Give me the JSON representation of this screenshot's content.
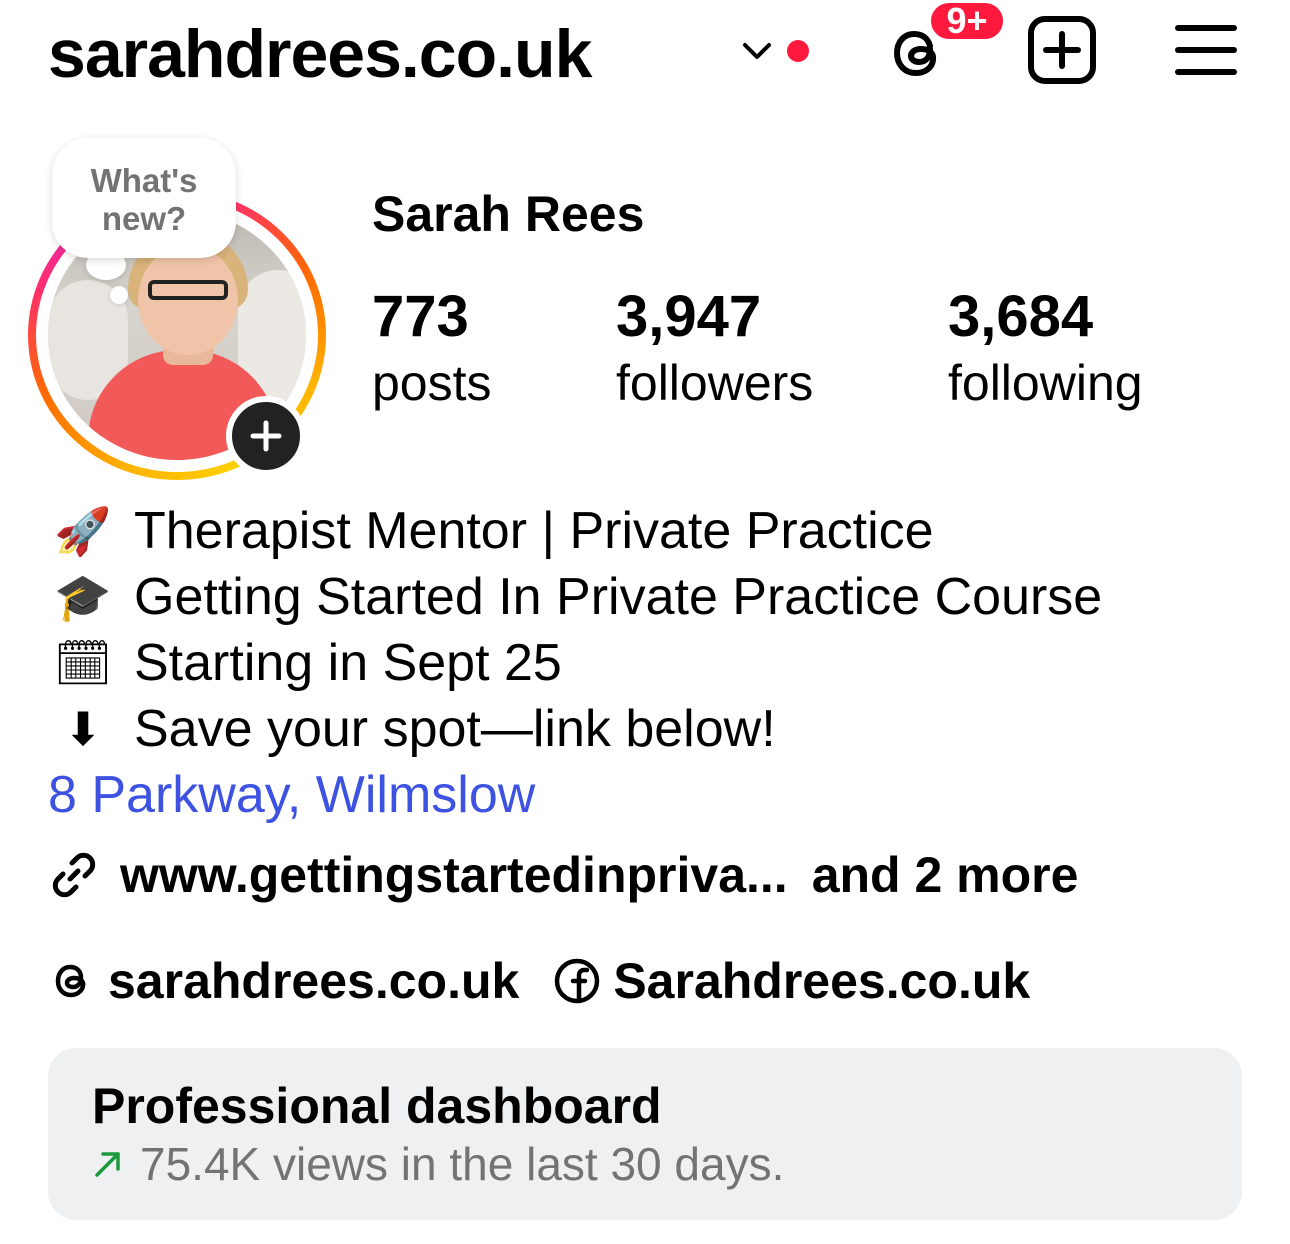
{
  "header": {
    "username": "sarahdrees.co.uk",
    "notification_badge": "9+",
    "icons": [
      "chevron-down-icon",
      "threads-icon",
      "create-post-icon",
      "menu-icon"
    ]
  },
  "profile": {
    "note_bubble": {
      "line1": "What's",
      "line2": "new?"
    },
    "full_name": "Sarah Rees",
    "stats": [
      {
        "value": "773",
        "label": "posts"
      },
      {
        "value": "3,947",
        "label": "followers"
      },
      {
        "value": "3,684",
        "label": "following"
      }
    ],
    "bio": [
      {
        "emoji": "🚀",
        "icon": "rocket-icon",
        "text": "Therapist Mentor | Private Practice"
      },
      {
        "emoji": "🎓",
        "icon": "graduation-cap-icon",
        "text": "Getting Started In Private Practice Course"
      },
      {
        "emoji": "🗓",
        "icon": "calendar-icon",
        "text": "Starting in Sept 25"
      },
      {
        "emoji": "⬇",
        "icon": "down-arrow-icon",
        "text": "Save your spot—link below!"
      }
    ],
    "address": "8 Parkway, Wilmslow",
    "link": {
      "url": "www.gettingstartedinpriva...",
      "more": "and 2 more"
    },
    "social": [
      {
        "icon": "threads-icon",
        "label": "sarahdrees.co.uk"
      },
      {
        "icon": "facebook-icon",
        "label": "Sarahdrees.co.uk"
      }
    ]
  },
  "dashboard": {
    "title": "Professional dashboard",
    "subtitle": "75.4K views in the last 30 days."
  },
  "colors": {
    "accent_blue": "#3d52e0",
    "notification_red": "#ff1a3d",
    "dashboard_bg": "#eff0f2",
    "trend_green": "#1a9a3c"
  }
}
